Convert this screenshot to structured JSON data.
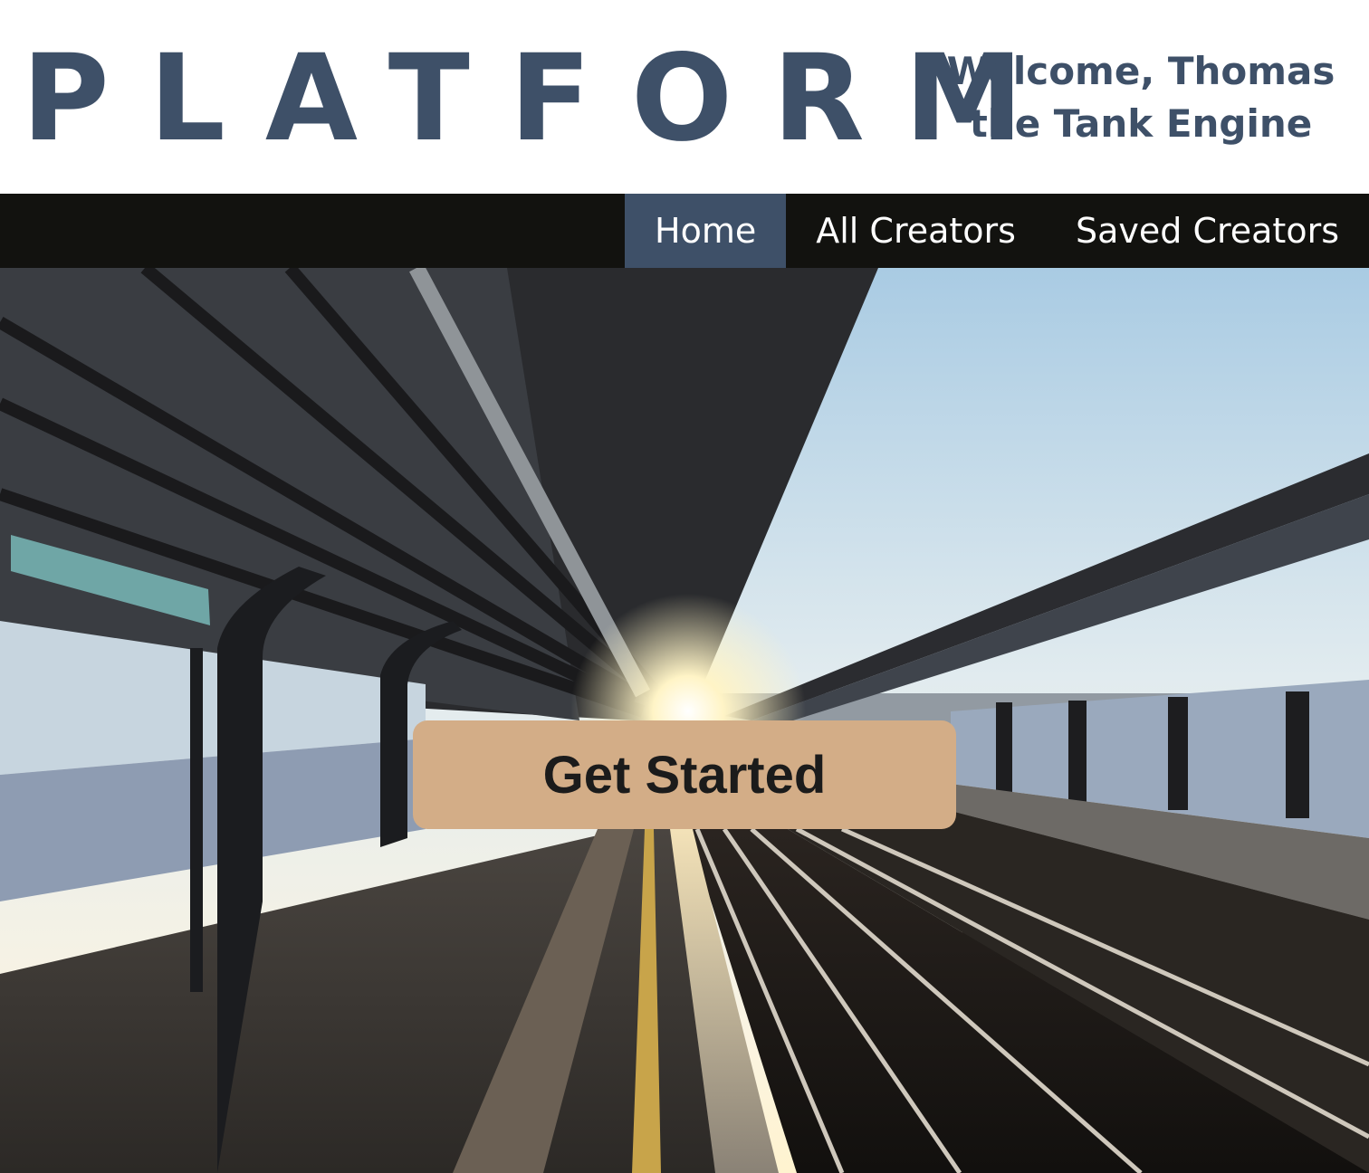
{
  "header": {
    "logo_text": "PLATFORM",
    "welcome_line1": "Welcome, Thomas",
    "welcome_line2": "the Tank Engine"
  },
  "nav": {
    "items": [
      {
        "label": "Home",
        "active": true
      },
      {
        "label": "All Creators",
        "active": false
      },
      {
        "label": "Saved Creators",
        "active": false
      }
    ]
  },
  "hero": {
    "image": "train-station-platform-sunset-photo",
    "cta_label": "Get Started"
  },
  "colors": {
    "brand": "#3e5068",
    "navbar_bg": "#12120f",
    "cta_bg": "#d3ad87",
    "cta_text": "#1b1b1b"
  }
}
